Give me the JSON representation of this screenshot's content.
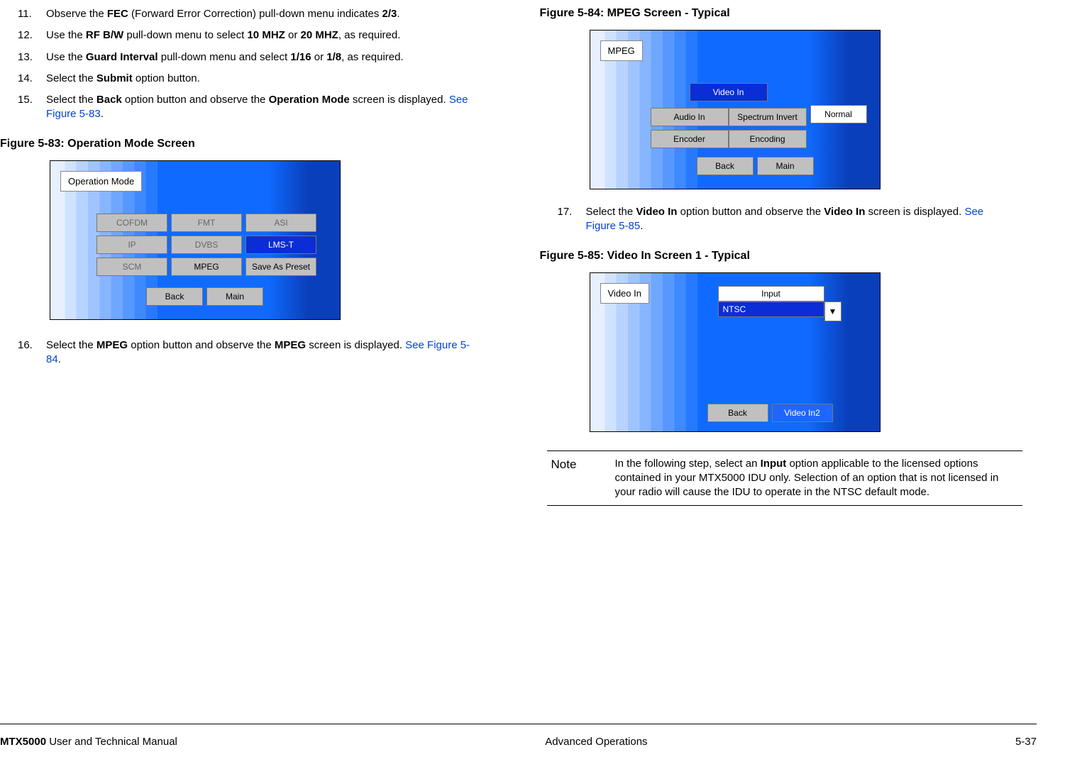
{
  "left": {
    "steps": [
      {
        "num": "11.",
        "html": "Observe the <b>FEC</b> (Forward Error Correction) pull-down menu indicates <b>2/3</b>."
      },
      {
        "num": "12.",
        "html": " Use the <b>RF B/W</b> pull-down menu to select <b>10 MHZ</b> or <b>20 MHZ</b>, as required."
      },
      {
        "num": "13.",
        "html": "Use the <b>Guard Interval</b> pull-down menu and select <b>1/16</b> or <b>1/8</b>, as required."
      },
      {
        "num": "14.",
        "html": "Select the <b>Submit</b> option button."
      },
      {
        "num": "15.",
        "html": "Select the <b>Back</b> option button and observe the <b>Operation Mode</b> screen is displayed. <span class=\"link\">See Figure 5-83</span>."
      }
    ],
    "fig83_caption": "Figure 5-83:   Operation Mode Screen",
    "fig83": {
      "title": "Operation Mode",
      "grid": [
        {
          "label": "COFDM",
          "cls": "btn-gray-dim"
        },
        {
          "label": "FMT",
          "cls": "btn-gray-dim"
        },
        {
          "label": "ASI",
          "cls": "btn-gray-dim"
        },
        {
          "label": "IP",
          "cls": "btn-gray-dim"
        },
        {
          "label": "DVBS",
          "cls": "btn-gray-dim"
        },
        {
          "label": "LMS-T",
          "cls": "btn-blue"
        },
        {
          "label": "SCM",
          "cls": "btn-gray-dim"
        },
        {
          "label": "MPEG",
          "cls": "btn-gray"
        },
        {
          "label": "Save As Preset",
          "cls": "btn-gray"
        }
      ],
      "nav": [
        {
          "label": "Back",
          "cls": "btn-gray"
        },
        {
          "label": "Main",
          "cls": "btn-gray"
        }
      ]
    },
    "step16": {
      "num": "16.",
      "html": "Select the <b>MPEG</b> option button and observe the <b>MPEG</b> screen is displayed.  <span class=\"link\">See Figure 5-84</span>."
    }
  },
  "right": {
    "fig84_caption": "Figure 5-84:   MPEG Screen - Typical",
    "fig84": {
      "title": "MPEG",
      "video_in": "Video In",
      "rows": [
        [
          {
            "label": "Audio In",
            "cls": "btn-gray"
          },
          {
            "label": "Spectrum Invert",
            "cls": "btn-gray"
          }
        ],
        [
          {
            "label": "Encoder",
            "cls": "btn-gray"
          },
          {
            "label": "Encoding",
            "cls": "btn-gray"
          }
        ]
      ],
      "normal": "Normal",
      "nav": [
        {
          "label": "Back",
          "cls": "btn-gray"
        },
        {
          "label": "Main",
          "cls": "btn-gray"
        }
      ]
    },
    "step17": {
      "num": "17.",
      "html": "Select the <b>Video In</b> option button and observe the <b>Video In</b> screen is displayed.  <span class=\"link\">See Figure 5-85</span>."
    },
    "fig85_caption": "Figure 5-85:   Video In Screen 1 - Typical",
    "fig85": {
      "title": "Video In",
      "input_label": "Input",
      "input_value": "NTSC",
      "arrow": "▼",
      "nav": [
        {
          "label": "Back",
          "cls": "btn-gray"
        },
        {
          "label": "Video In2",
          "cls": "btn-blue-lt"
        }
      ]
    },
    "note": {
      "label": "Note",
      "body": "In the following step, select an <b>Input</b> option applicable to the licensed options contained in your MTX5000 IDU only.  Selection of an option that is not licensed in your radio will cause the IDU to operate in the NTSC default mode."
    }
  },
  "footer": {
    "left": "<b>MTX5000</b> User and Technical Manual",
    "center": "Advanced Operations",
    "right": "5-37"
  }
}
